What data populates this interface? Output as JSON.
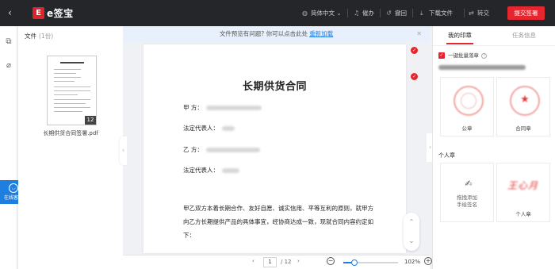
{
  "topbar": {
    "brand": "e签宝",
    "logo_letter": "E",
    "items": [
      {
        "icon": "globe-icon",
        "label": "简体中文 ⌄"
      },
      {
        "icon": "bell-icon",
        "label": "催办"
      },
      {
        "icon": "undo-icon",
        "label": "撤回"
      },
      {
        "icon": "download-icon",
        "label": "下载文件"
      },
      {
        "icon": "transfer-icon",
        "label": "转交"
      }
    ],
    "submit_label": "提交签署"
  },
  "filepanel": {
    "title": "文件",
    "count": "(1份)",
    "file_name": "长期供货合同签署.pdf",
    "page_count": "12"
  },
  "support_label": "在线客服",
  "notice": {
    "text": "文件预览有问题? 你可以点击此处",
    "link": "重新加载"
  },
  "document": {
    "title": "长期供货合同",
    "party_a_label": "甲 方：",
    "rep_a_label": "法定代表人：",
    "party_b_label": "乙 方：",
    "rep_b_label": "法定代表人：",
    "paragraph": "甲乙双方本着长期合作、友好自愿、诚实信用、平等互利的原则，就甲方向乙方长期提供产品的具体事宜，经协商达成一致，现就合同内容约定如下："
  },
  "pager": {
    "prev": "‹",
    "current": "1",
    "total": "/ 12",
    "next": "›",
    "zoom": "102%",
    "zoom_level": 0.2
  },
  "rightpanel": {
    "tab_seals": "我的印章",
    "tab_tasks": "任务信息",
    "batch_label": "一键批量落章",
    "seals": [
      {
        "label": "公章"
      },
      {
        "label": "合同章"
      }
    ],
    "personal_section": "个人章",
    "add_signature": "拖拽添加\n手绘签名",
    "personal_seal": "个人章",
    "personal_seal_text": "王心月"
  }
}
